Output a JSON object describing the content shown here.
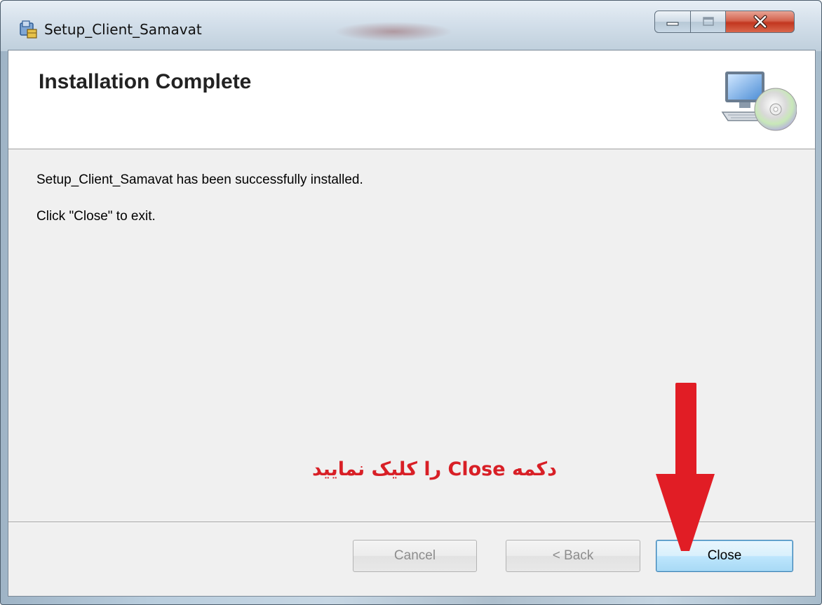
{
  "window": {
    "title": "Setup_Client_Samavat",
    "icons": {
      "app": "installer-icon",
      "minimize": "minimize-icon",
      "maximize": "maximize-icon",
      "close": "close-icon"
    }
  },
  "header": {
    "title": "Installation Complete",
    "icon": "computer-cd-icon"
  },
  "body": {
    "message": "Setup_Client_Samavat has been successfully installed.",
    "instruction": "Click \"Close\" to exit."
  },
  "annotation": {
    "text": "دکمه Close را کلیک نمایید",
    "color": "#d81f26",
    "arrow_icon": "arrow-down-icon"
  },
  "buttons": {
    "cancel": "Cancel",
    "back": "< Back",
    "close": "Close"
  },
  "colors": {
    "annotation": "#d81f26",
    "default_button_border": "#3c7fb1"
  }
}
